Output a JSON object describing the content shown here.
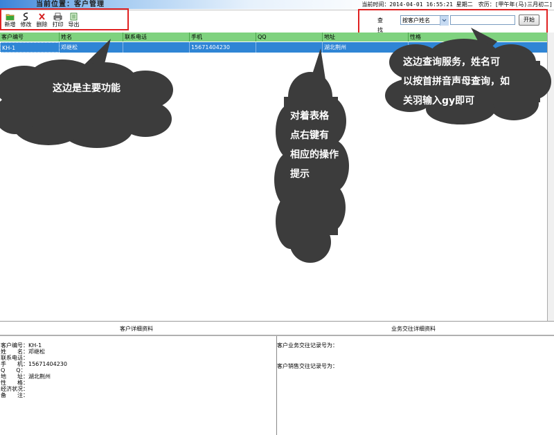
{
  "titlebar": {
    "location": "当前位置：客户管理",
    "datetime": "当前时间：2014-04-01 16:55:21 星期二　农历：[甲午年(马)三月初二]"
  },
  "toolbar": {
    "buttons": [
      {
        "label": "新增",
        "icon": "folder-add-icon"
      },
      {
        "label": "修改",
        "icon": "edit-icon"
      },
      {
        "label": "删除",
        "icon": "delete-x-icon"
      },
      {
        "label": "打印",
        "icon": "printer-icon"
      },
      {
        "label": "导出",
        "icon": "export-icon"
      }
    ]
  },
  "search": {
    "label": "查找",
    "field_selected": "按客户姓名",
    "query": "",
    "button": "开始"
  },
  "grid": {
    "columns": [
      "客户编号",
      "姓名",
      "联系电话",
      "手机",
      "QQ",
      "地址",
      "性格"
    ],
    "rows": [
      [
        "KH-1",
        "邓继松",
        "",
        "15671404230",
        "",
        "湖北荆州",
        ""
      ]
    ]
  },
  "panels": {
    "detail_title": "客户详细资料",
    "business_title": "业务交往详细资料"
  },
  "detail": [
    {
      "key": "客户编号：",
      "value": "KH-1"
    },
    {
      "key": "姓　　名：",
      "value": "邓继松"
    },
    {
      "key": "联系电话：",
      "value": ""
    },
    {
      "key": "手　　机：",
      "value": "15671404230"
    },
    {
      "key": "Q　　Q：",
      "value": ""
    },
    {
      "key": "地　　址：",
      "value": "湖北荆州"
    },
    {
      "key": "性　　格：",
      "value": ""
    },
    {
      "key": "经济状况：",
      "value": ""
    },
    {
      "key": "备　　注：",
      "value": ""
    }
  ],
  "business": {
    "record_label": "客户业务交往记录号为：",
    "sales_label": "客户销售交往记录号为："
  },
  "annotations": {
    "main_function": "这边是主要功能",
    "right_click": [
      "对着表格",
      "点右键有",
      "相应的操作",
      "提示"
    ],
    "search_help": [
      "这边查询服务，姓名可",
      "以按首拼音声母查询，如",
      "关羽输入gy即可"
    ]
  },
  "colors": {
    "header_green": "#7fd27f",
    "selected_row_blue": "#2f85d5",
    "highlight_red": "#e02020",
    "bubble_dark": "#3c3c3c"
  }
}
